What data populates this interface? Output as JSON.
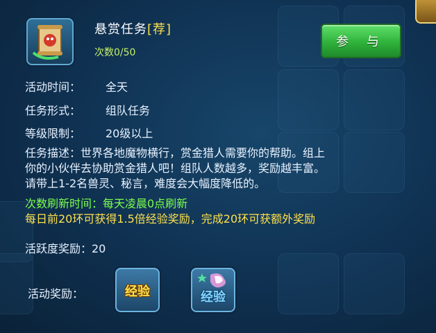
{
  "task": {
    "icon": "bounty-scroll-icon",
    "title": "悬赏任务",
    "tag": "[荐]",
    "count_text": "次数0/50",
    "join_label": "参 与"
  },
  "info": {
    "time_label": "活动时间：",
    "time_value": "全天",
    "form_label": "任务形式：",
    "form_value": "组队任务",
    "level_label": "等级限制：",
    "level_value": "20级以上"
  },
  "description": {
    "line1": "任务描述：世界各地魔物横行，赏金猎人需要你的帮助。组上",
    "line2": "你的小伙伴去协助赏金猎人吧！组队人数越多，奖励越丰富。",
    "line3": "请带上1-2名兽灵、秘言，难度会大幅度降低的。"
  },
  "refresh_text": "次数刷新时间：每天凌晨0点刷新",
  "bonus_text": "每日前20环可获得1.5倍经验奖励，完成20环可获额外奖励",
  "activity_text": "活跃度奖励：20",
  "rewards": {
    "label": "活动奖励：",
    "items": [
      {
        "text": "经验",
        "icon": "exp-reward-icon"
      },
      {
        "text": "经验",
        "icon": "exp-star-reward-icon"
      }
    ]
  },
  "colors": {
    "yellow": "#ffe14d",
    "green_text": "#7dff4d",
    "count_green": "#c6f06a",
    "button_green": "#2fb23b"
  }
}
